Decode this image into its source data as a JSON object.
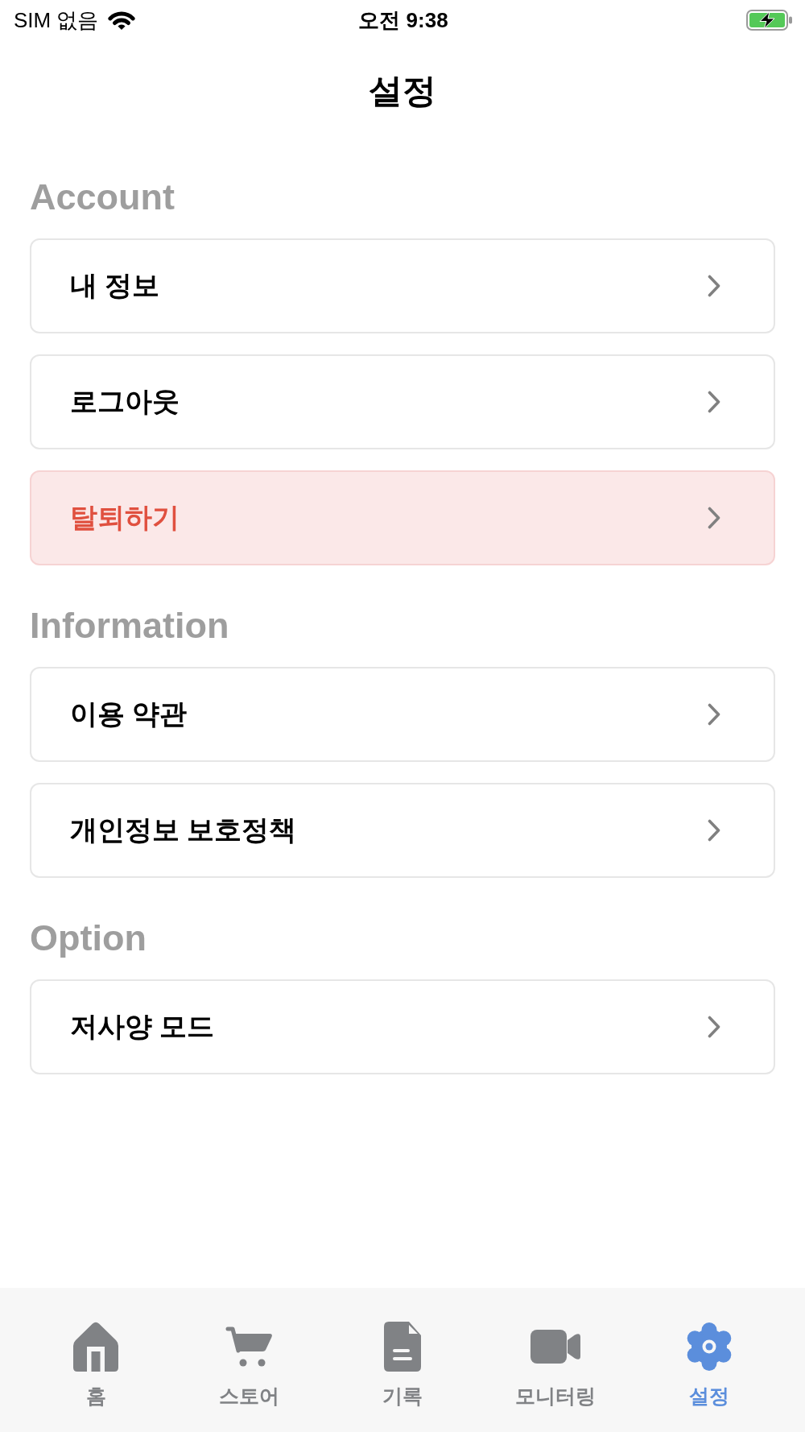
{
  "status_bar": {
    "carrier": "SIM 없음",
    "time": "오전 9:38"
  },
  "header": {
    "title": "설정"
  },
  "sections": [
    {
      "title": "Account",
      "items": [
        {
          "label": "내 정보",
          "kind": "default"
        },
        {
          "label": "로그아웃",
          "kind": "default"
        },
        {
          "label": "탈퇴하기",
          "kind": "danger"
        }
      ]
    },
    {
      "title": "Information",
      "items": [
        {
          "label": "이용 약관",
          "kind": "default"
        },
        {
          "label": "개인정보 보호정책",
          "kind": "default"
        }
      ]
    },
    {
      "title": "Option",
      "items": [
        {
          "label": "저사양 모드",
          "kind": "default"
        }
      ]
    }
  ],
  "tab_bar": {
    "tabs": [
      {
        "label": "홈",
        "selected": false
      },
      {
        "label": "스토어",
        "selected": false
      },
      {
        "label": "기록",
        "selected": false
      },
      {
        "label": "모니터링",
        "selected": false
      },
      {
        "label": "설정",
        "selected": true
      }
    ]
  }
}
